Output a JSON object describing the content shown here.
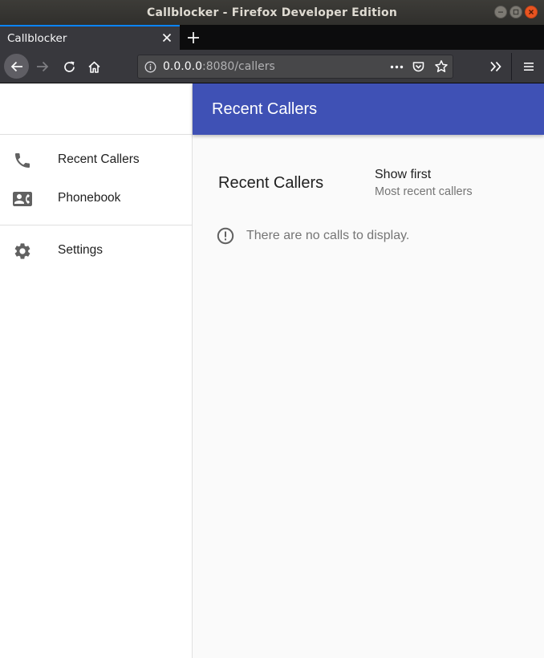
{
  "window": {
    "title": "Callblocker - Firefox Developer Edition"
  },
  "tabs": [
    {
      "label": "Callblocker"
    }
  ],
  "urlbar": {
    "host": "0.0.0.0",
    "rest": ":8080/callers"
  },
  "drawer": {
    "items": [
      {
        "label": "Recent Callers",
        "icon": "phone-icon"
      },
      {
        "label": "Phonebook",
        "icon": "contact-card-icon"
      },
      {
        "label": "Settings",
        "icon": "gear-icon"
      }
    ]
  },
  "appbar": {
    "title": "Recent Callers"
  },
  "content": {
    "section_title": "Recent Callers",
    "show_first": {
      "label": "Show first",
      "value": "Most recent callers"
    },
    "empty_message": "There are no calls to display."
  },
  "colors": {
    "appbar": "#3f51b5",
    "tab_accent": "#0a84ff",
    "close_button": "#e95420"
  }
}
